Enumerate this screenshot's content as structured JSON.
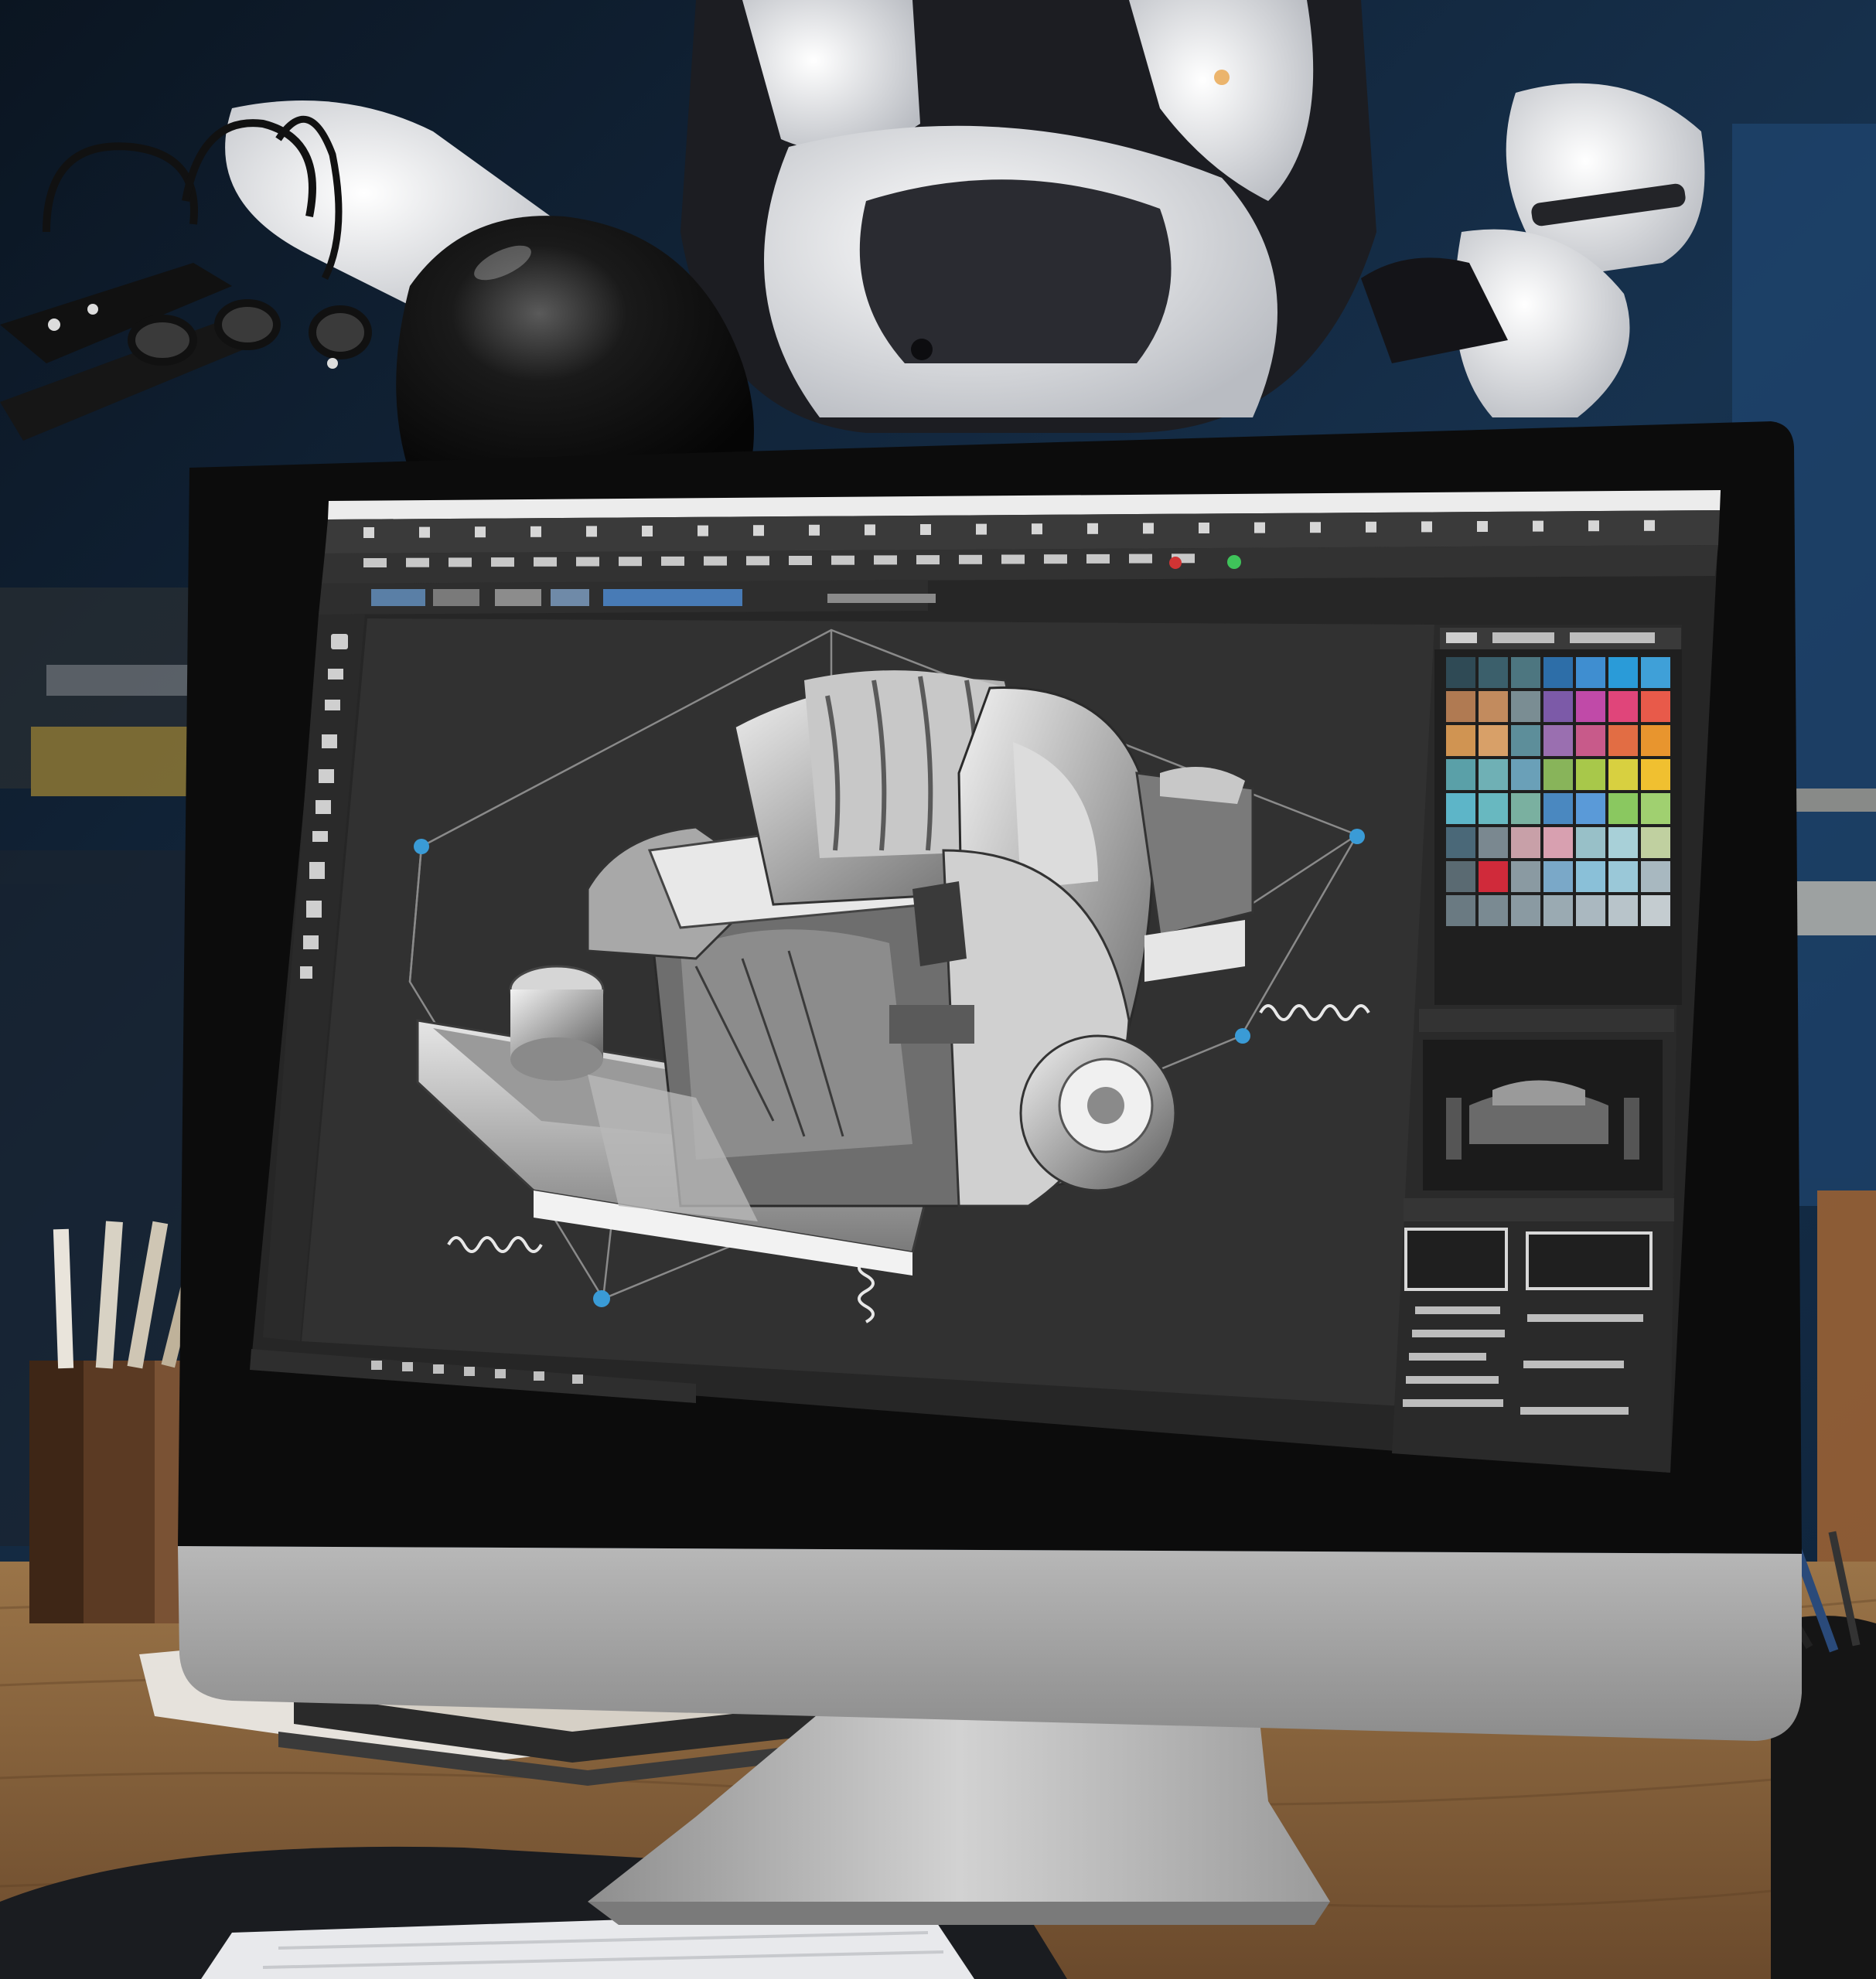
{
  "scene": {
    "kind": "photo-cad-workstation",
    "colors": {
      "background": "#0f1e2e",
      "wall_blue": "#1c3a5c",
      "desk_wood": "#8a6440",
      "monitor_frame": "#0c0c0c",
      "monitor_body": "#a8a8a8",
      "app_background": "#2b2b2b",
      "viewport": "#303030",
      "toolbar_top": "#ececec",
      "selection_handle": "#3a9bd6",
      "robot_white": "#e9e9ec",
      "robot_dark": "#222226",
      "lamp": "#111111"
    }
  },
  "cad_app": {
    "model_icon": "engine-assembly-icon",
    "toolbar_icon_count": 24,
    "left_tool_count": 11,
    "status_green": "#3fc35a",
    "status_red": "#d13434"
  },
  "swatches": [
    "#2f4a55",
    "#3b5f6b",
    "#4d7680",
    "#2d6ea8",
    "#3f8ed0",
    "#2a9bd8",
    "#3fa0d8",
    "#b07a52",
    "#c28b5e",
    "#7a8d93",
    "#7c5aa8",
    "#c04aa8",
    "#e0457a",
    "#e85a4a",
    "#d09452",
    "#d8a068",
    "#5d8e9a",
    "#9a6fb0",
    "#c85a8a",
    "#e26d44",
    "#e8952e",
    "#5aa0a8",
    "#6fb0b5",
    "#6aa0b8",
    "#88b45a",
    "#a8c84a",
    "#d8d040",
    "#f0c030",
    "#5db5c8",
    "#68b8c0",
    "#7ab0a0",
    "#4a88c0",
    "#5a9ad8",
    "#8ac860",
    "#a0d070",
    "#4a6878",
    "#7a8890",
    "#c8a0a8",
    "#d8a0b0",
    "#98c0c8",
    "#a8d0d8",
    "#c0d0a0",
    "#5a6a72",
    "#d02a3a",
    "#8a9aa2",
    "#7aa8c8",
    "#8ac0d8",
    "#9ac8d8",
    "#a8b8c0",
    "#6a7a82",
    "#7a8a92",
    "#8a9aa2",
    "#9aaab2",
    "#aab8c0",
    "#b8c4ca",
    "#c4ccd0"
  ]
}
